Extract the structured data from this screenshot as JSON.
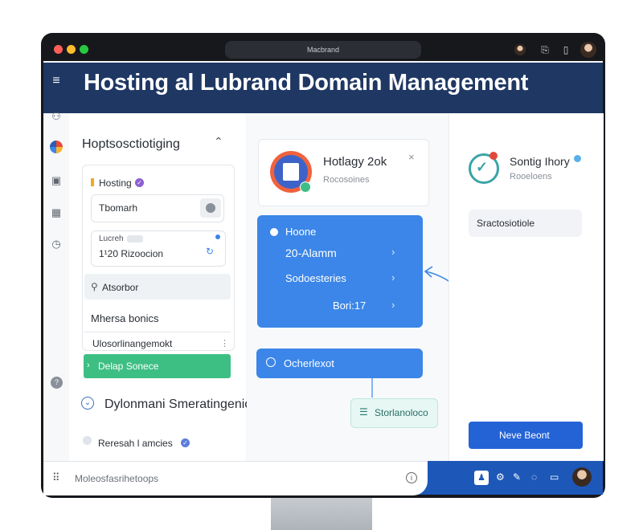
{
  "window": {
    "address": "Macbrand"
  },
  "header": {
    "title": "Hosting al Lubrand Domain Management"
  },
  "left_panel": {
    "section_title": "Hoptsosctiotiging",
    "hosting_label": "Hosting",
    "domain_field": "Tbomarh",
    "info_label": "Lucreh",
    "info_badge": "",
    "info_value": "1¹20 Rizoocion",
    "search_text": "Atsorbor",
    "item1": "Mhersa bonics",
    "item2": "Ulosorlinangemokt",
    "action_label": "Delap Sonece"
  },
  "section2": {
    "title": "Dylonmani Smeratingeniory",
    "sub_item": "Reresah l amcies"
  },
  "mid": {
    "card_title": "Hotlagy 2ok",
    "card_sub": "Rocosoines",
    "blue_header": "Hoone",
    "blue_items": [
      "20-Alamm",
      "Sodoesteries",
      "Bori:17"
    ],
    "button": "Ocherlexot",
    "tag": "Storlanoloco"
  },
  "right": {
    "status_title": "Sontig Ihory",
    "status_sub": "Rooeloens",
    "search_field": "Sractosiotiole",
    "new_button": "Neve Beont"
  },
  "bottom": {
    "input_placeholder": "Moleosfasrihetoops"
  },
  "colors": {
    "accent": "#3b86e8",
    "header": "#1f3763",
    "green": "#3dbf84",
    "bottom_bar": "#1d58b8"
  }
}
